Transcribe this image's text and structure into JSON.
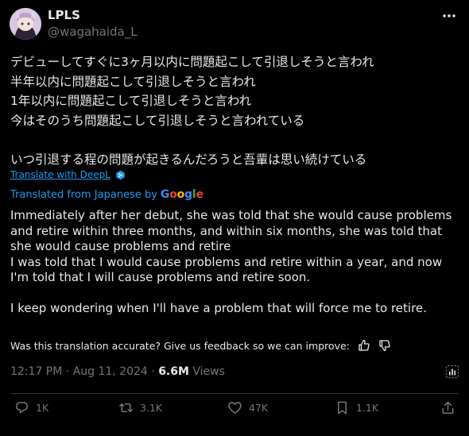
{
  "author": {
    "name": "LPLS",
    "handle": "@wagahaida_L"
  },
  "original_text": [
    "デビューしてすぐに3ヶ月以内に問題起こして引退しそうと言われ",
    "半年以内に問題起こして引退しそうと言われ",
    "1年以内に問題起こして引退しそうと言われ",
    "今はそのうち問題起こして引退しそうと言われている",
    "",
    "いつ引退する程の問題が起きるんだろうと吾輩は思い続けている"
  ],
  "translate_link": "Translate with DeepL",
  "translated_from": "Translated from Japanese by",
  "google_logo": "Google",
  "translation": [
    "Immediately after her debut, she was told that she would cause problems and retire within three months, and within six months, she was told that she would cause problems and retire",
    "I was told that I would cause problems and retire within a year, and now I'm told that I will cause problems and retire soon.",
    "",
    "I keep wondering when I'll have a problem that will force me to retire."
  ],
  "feedback_prompt": "Was this translation accurate? Give us feedback so we can improve:",
  "meta": {
    "time": "12:17 PM",
    "date": "Aug 11, 2024",
    "views_count": "6.6M",
    "views_label": "Views"
  },
  "actions": {
    "replies": "1K",
    "reposts": "3.1K",
    "likes": "47K",
    "bookmarks": "1.1K"
  },
  "colors": {
    "background": "#000000",
    "text": "#e7e9ea",
    "muted": "#71767b",
    "link": "#1d9bf0",
    "divider": "#2f3336"
  },
  "icons": [
    "more-icon",
    "deepl-icon",
    "thumbs-up-icon",
    "thumbs-down-icon",
    "analytics-icon",
    "reply-icon",
    "repost-icon",
    "like-icon",
    "bookmark-icon",
    "share-icon"
  ]
}
